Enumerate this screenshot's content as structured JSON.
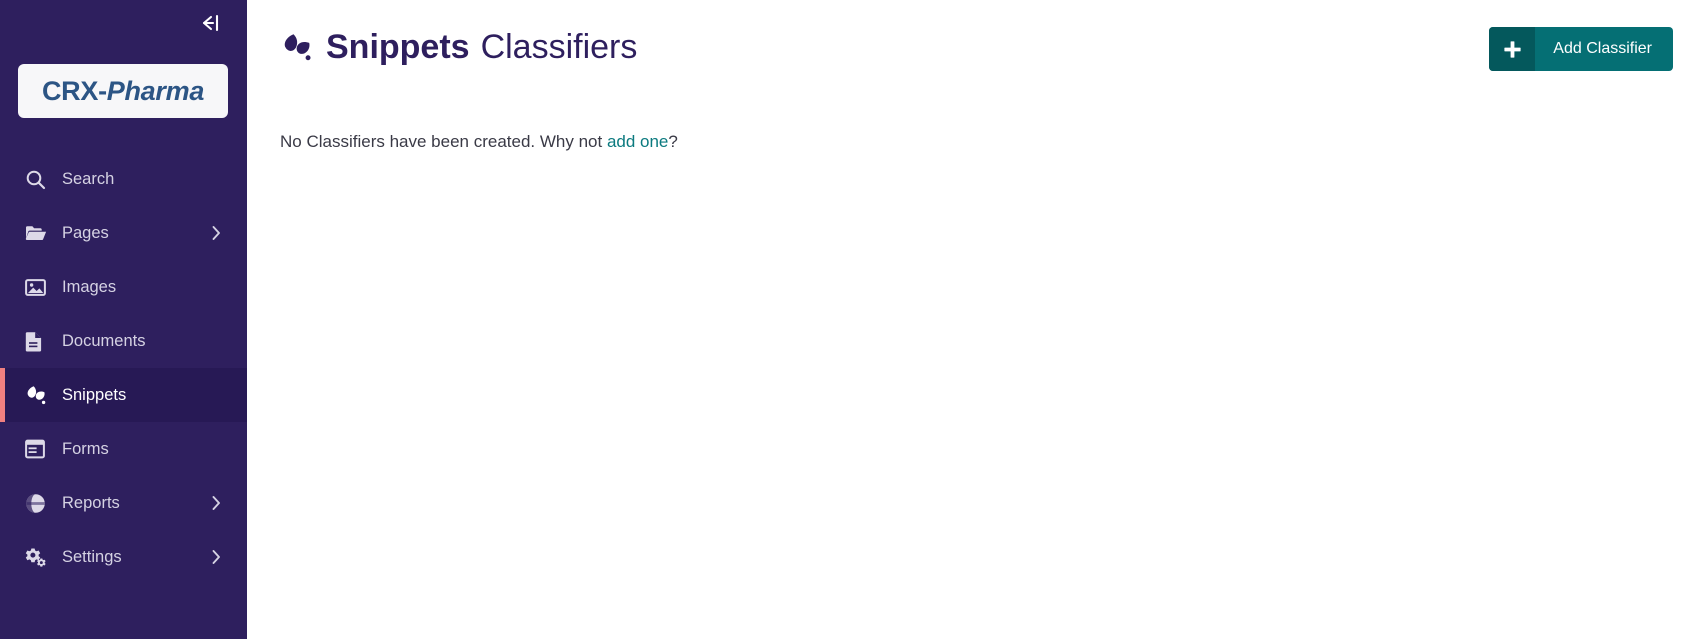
{
  "sidebar": {
    "collapse_icon": "collapse-left-icon",
    "logo": {
      "part_one": "CRX-",
      "part_two": "Pharma"
    },
    "items": [
      {
        "label": "Search",
        "icon": "search-icon",
        "active": false,
        "has_chevron": false
      },
      {
        "label": "Pages",
        "icon": "folder-open-icon",
        "active": false,
        "has_chevron": true
      },
      {
        "label": "Images",
        "icon": "image-icon",
        "active": false,
        "has_chevron": false
      },
      {
        "label": "Documents",
        "icon": "document-icon",
        "active": false,
        "has_chevron": false
      },
      {
        "label": "Snippets",
        "icon": "snippet-leaf-icon",
        "active": true,
        "has_chevron": false
      },
      {
        "label": "Forms",
        "icon": "form-list-icon",
        "active": false,
        "has_chevron": false
      },
      {
        "label": "Reports",
        "icon": "globe-chart-icon",
        "active": false,
        "has_chevron": true
      },
      {
        "label": "Settings",
        "icon": "cogs-icon",
        "active": false,
        "has_chevron": true
      }
    ]
  },
  "header": {
    "icon": "snippet-leaf-icon",
    "title_strong": "Snippets",
    "title_rest": "Classifiers",
    "add_button": {
      "label": "Add Classifier",
      "icon": "plus-icon"
    }
  },
  "content": {
    "empty_message_before": "No Classifiers have been created. Why not ",
    "empty_message_link": "add one",
    "empty_message_after": "?"
  },
  "colors": {
    "sidebar_bg": "#2E1F5E",
    "sidebar_active_bg": "#271955",
    "active_accent": "#f08080",
    "title": "#2E1F5E",
    "button_teal": "#056F74",
    "button_teal_dark": "#04585c",
    "link_teal": "#0b7a7f",
    "logo_blue": "#2c5585"
  }
}
